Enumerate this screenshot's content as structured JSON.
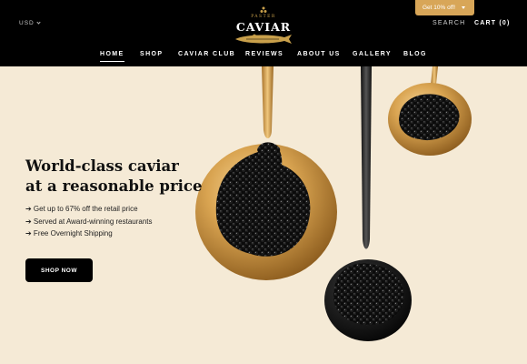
{
  "header": {
    "currency": "USD",
    "logo": {
      "tagline": "Paster",
      "name": "CAVIAR"
    },
    "promo": "Get 10% off!",
    "search": "SEARCH",
    "cart": "CART (0)",
    "nav": [
      {
        "label": "HOME",
        "active": true
      },
      {
        "label": "SHOP"
      },
      {
        "label": "CAVIAR CLUB"
      },
      {
        "label": "REVIEWS"
      },
      {
        "label": "ABOUT US"
      },
      {
        "label": "GALLERY"
      },
      {
        "label": "BLOG"
      }
    ]
  },
  "hero": {
    "title_line1": "World-class caviar",
    "title_line2": "at a reasonable price",
    "bullets": [
      "➔ Get up to 67% off the retail price",
      "➔ Served at Award-winning restaurants",
      "➔ Free Overnight Shipping"
    ],
    "cta": "SHOP NOW"
  },
  "colors": {
    "header_bg": "#000000",
    "accent_gold": "#d8a658",
    "hero_bg": "#f5ead6"
  }
}
